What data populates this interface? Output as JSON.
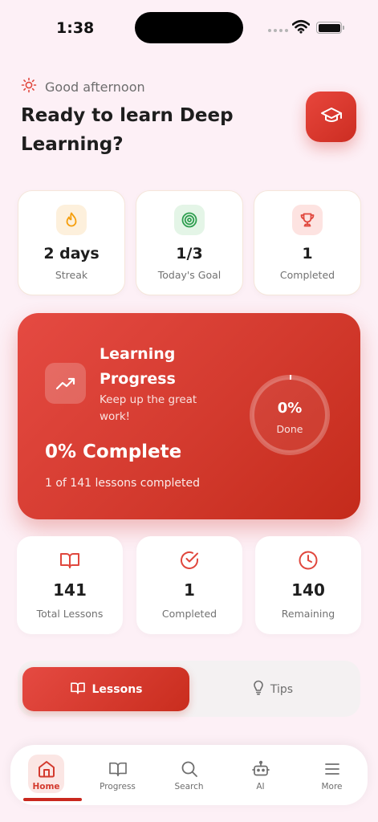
{
  "status": {
    "time": "1:38"
  },
  "header": {
    "greeting": "Good afternoon",
    "title": "Ready to learn Deep Learning?"
  },
  "stats": [
    {
      "icon": "flame-icon",
      "value": "2 days",
      "label": "Streak",
      "color": "#f59e0b",
      "bg": "#fdf0dc"
    },
    {
      "icon": "target-icon",
      "value": "1/3",
      "label": "Today's Goal",
      "color": "#2e9e4f",
      "bg": "#e4f5e7"
    },
    {
      "icon": "trophy-icon",
      "value": "1",
      "label": "Completed",
      "color": "#e0473d",
      "bg": "#fde3e1"
    }
  ],
  "progress": {
    "title": "Learning Progress",
    "subtitle": "Keep up the great work!",
    "complete_text": "0% Complete",
    "lessons_text": "1 of 141 lessons completed",
    "ring_percent": "0%",
    "ring_label": "Done",
    "fraction": 0.007
  },
  "lesson_stats": [
    {
      "icon": "book-open-icon",
      "value": "141",
      "label": "Total Lessons"
    },
    {
      "icon": "check-circle-icon",
      "value": "1",
      "label": "Completed"
    },
    {
      "icon": "clock-icon",
      "value": "140",
      "label": "Remaining"
    }
  ],
  "segment": {
    "active_label": "Lessons",
    "inactive_label": "Tips"
  },
  "nav": [
    {
      "label": "Home",
      "icon": "home-icon"
    },
    {
      "label": "Progress",
      "icon": "book-icon"
    },
    {
      "label": "Search",
      "icon": "search-icon"
    },
    {
      "label": "AI",
      "icon": "robot-icon"
    },
    {
      "label": "More",
      "icon": "menu-icon"
    }
  ],
  "colors": {
    "accent": "#d33a2e",
    "background": "#fdf0f6"
  }
}
